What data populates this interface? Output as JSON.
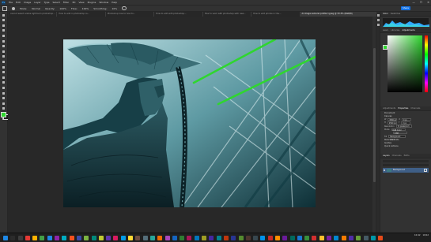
{
  "menu": {
    "logo": "Ps",
    "items": [
      "File",
      "Edit",
      "Image",
      "Layer",
      "Type",
      "Select",
      "Filter",
      "3D",
      "View",
      "Plugins",
      "Window",
      "Help"
    ]
  },
  "window_controls": [
    "—",
    "☐",
    "✕"
  ],
  "options_bar": {
    "mode_label": "Mode:",
    "mode_value": "Normal",
    "opacity_label": "Opacity:",
    "opacity_value": "100%",
    "flow_label": "Flow:",
    "flow_value": "100%",
    "smoothing_label": "Smoothing:",
    "smoothing_value": "10%",
    "share_label": "Share"
  },
  "tabs": [
    {
      "label": "cannot select adobe lightroom photoshop...",
      "active": false
    },
    {
      "label": "How to edit in photoshop cs...",
      "active": false
    },
    {
      "label": "Photoshop how to how to...",
      "active": false
    },
    {
      "label": "How to edit with photoshop...",
      "active": false
    },
    {
      "label": "How to work with photoshop with new...",
      "active": false
    },
    {
      "label": "How to edit photos in the...",
      "active": false
    },
    {
      "label": "Ai image samurai profile 1.jpeg @ 33.3% (RGB/8)",
      "active": true
    }
  ],
  "panels": {
    "top_tabs": [
      "Color",
      "Swatches",
      "Gradients",
      "Patterns"
    ],
    "hist_tabs": [
      "Learn",
      "Libraries",
      "Adjustments"
    ],
    "properties_tabs": [
      "Adjustments",
      "Properties",
      "Channels"
    ],
    "properties": {
      "doc_label": "Document",
      "canvas_title": "Canvas",
      "w_label": "W",
      "w_value": "3840 px",
      "h_label": "H",
      "h_value": "2560 px",
      "x_label": "X",
      "x_value": "0 px",
      "y_label": "Y",
      "y_value": "0 px",
      "res_label": "Resolution",
      "res_value": "72 pixels/inch",
      "mode_label": "Mode",
      "mode_value": "RGB Color",
      "depth_value": "8 Bit",
      "fill_label": "Fill",
      "fill_value": "Background Color",
      "rulers_title": "Rulers & Grids",
      "guides_title": "Guides",
      "quick_title": "Quick Actions"
    },
    "layers_tabs": [
      "Layers",
      "Channels",
      "Paths"
    ],
    "layer_name": "Background"
  },
  "taskbar": {
    "icon_colors": [
      "#1e88e5",
      "#2b2b2b",
      "#3c3c3c",
      "#e53935",
      "#ffb300",
      "#43a047",
      "#1e88e5",
      "#8e24aa",
      "#00acc1",
      "#f4511e",
      "#3949ab",
      "#7cb342",
      "#00897b",
      "#c0ca33",
      "#5e35b1",
      "#d81b60",
      "#039be5",
      "#fdd835",
      "#6d4c41",
      "#546e7a",
      "#26a69a",
      "#ef6c00",
      "#ab47bc",
      "#1565c0",
      "#2e7d32",
      "#ad1457",
      "#0277bd",
      "#9e9d24",
      "#4527a0",
      "#00838f",
      "#bf360c",
      "#283593",
      "#558b2f",
      "#4e342e",
      "#37474f",
      "#0091ea",
      "#c62828",
      "#ff8f00",
      "#6a1b9a",
      "#00695c",
      "#1976d2",
      "#388e3c",
      "#d32f2f",
      "#fbc02d",
      "#7b1fa2",
      "#0288d1",
      "#f57c00",
      "#512da8",
      "#689f38",
      "#455a64",
      "#0097a7",
      "#e64a19"
    ],
    "time": "10:42",
    "date": "10/12"
  },
  "colors": {
    "foreground": "#2fd62f",
    "background": "#1b1b1b",
    "accent": "#1473e6"
  }
}
